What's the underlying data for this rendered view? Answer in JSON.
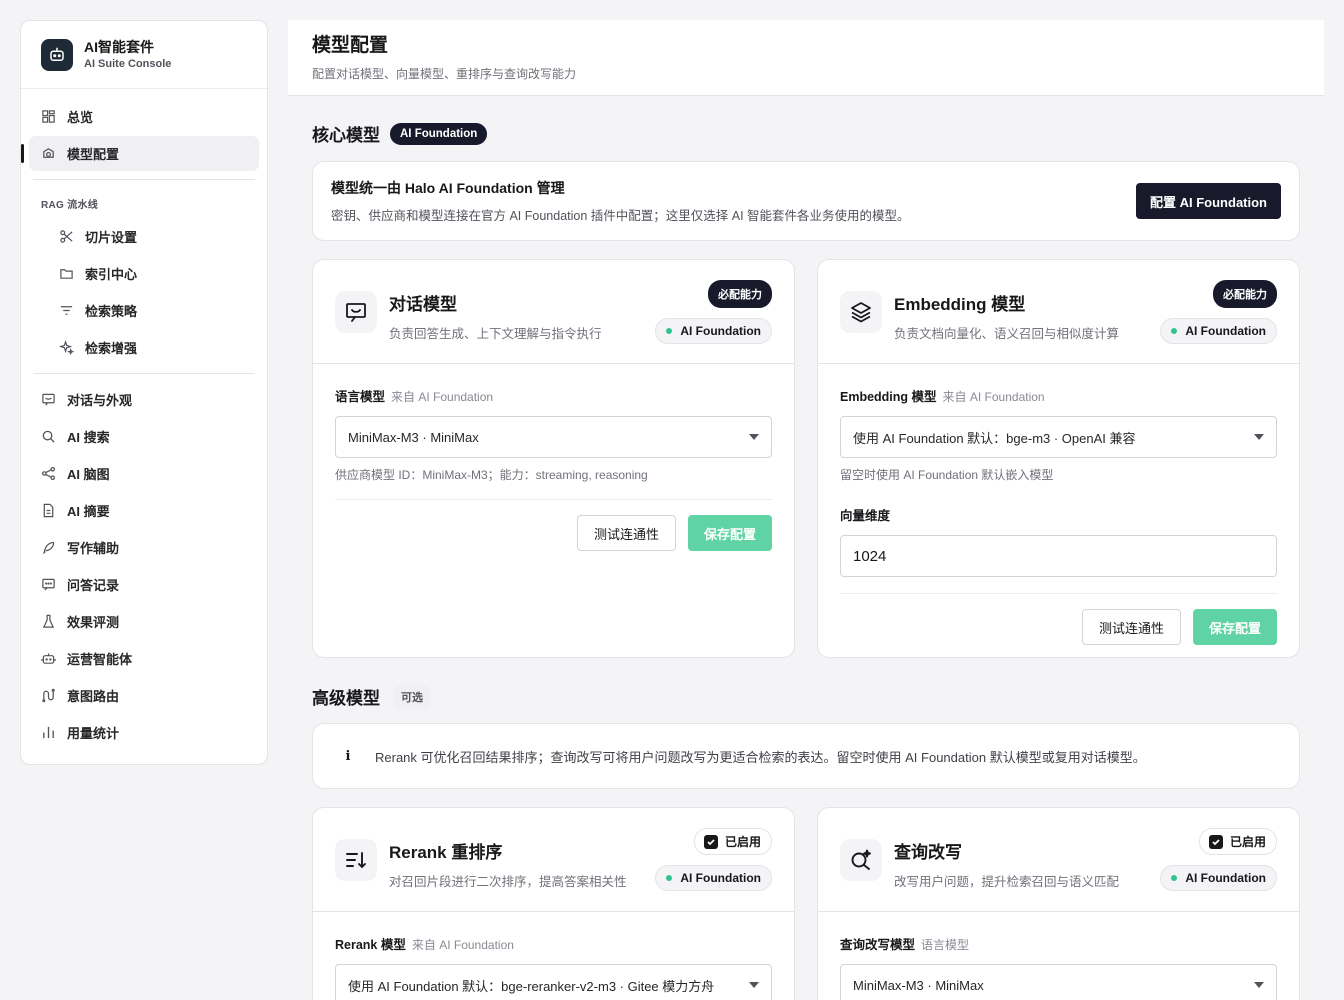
{
  "brand": {
    "title": "AI智能套件",
    "subtitle": "AI Suite Console"
  },
  "nav": {
    "items_top": [
      {
        "label": "总览",
        "icon": "grid-icon"
      },
      {
        "label": "模型配置",
        "icon": "model-icon",
        "active": true
      }
    ],
    "group_label": "RAG 流水线",
    "items_rag": [
      {
        "label": "切片设置",
        "icon": "scissors-icon"
      },
      {
        "label": "索引中心",
        "icon": "folder-icon"
      },
      {
        "label": "检索策略",
        "icon": "filter-icon"
      },
      {
        "label": "检索增强",
        "icon": "sparkle-icon"
      }
    ],
    "items_bottom": [
      {
        "label": "对话与外观",
        "icon": "chat-icon"
      },
      {
        "label": "AI 搜索",
        "icon": "search-icon"
      },
      {
        "label": "AI 脑图",
        "icon": "mindmap-icon"
      },
      {
        "label": "AI 摘要",
        "icon": "document-icon"
      },
      {
        "label": "写作辅助",
        "icon": "feather-icon"
      },
      {
        "label": "问答记录",
        "icon": "message-icon"
      },
      {
        "label": "效果评测",
        "icon": "flask-icon"
      },
      {
        "label": "运营智能体",
        "icon": "robot-icon"
      },
      {
        "label": "意图路由",
        "icon": "route-icon"
      },
      {
        "label": "用量统计",
        "icon": "bar-chart-icon"
      }
    ]
  },
  "header": {
    "title": "模型配置",
    "subtitle": "配置对话模型、向量模型、重排序与查询改写能力"
  },
  "core": {
    "title": "核心模型",
    "badge": "AI Foundation",
    "info_title": "模型统一由 Halo AI Foundation 管理",
    "info_desc": "密钥、供应商和模型连接在官方 AI Foundation 插件中配置；这里仅选择 AI 智能套件各业务使用的模型。",
    "config_button": "配置 AI Foundation"
  },
  "chat_card": {
    "title": "对话模型",
    "desc": "负责回答生成、上下文理解与指令执行",
    "badge_required": "必配能力",
    "badge_source": "AI Foundation",
    "field_label": "语言模型",
    "field_source": "来自 AI Foundation",
    "select_value": "MiniMax-M3 · MiniMax",
    "hint": "供应商模型 ID：MiniMax-M3；能力：streaming, reasoning",
    "test_button": "测试连通性",
    "save_button": "保存配置"
  },
  "embed_card": {
    "title": "Embedding 模型",
    "desc": "负责文档向量化、语义召回与相似度计算",
    "badge_required": "必配能力",
    "badge_source": "AI Foundation",
    "field_label": "Embedding 模型",
    "field_source": "来自 AI Foundation",
    "select_value": "使用 AI Foundation 默认：bge-m3 · OpenAI 兼容",
    "hint": "留空时使用 AI Foundation 默认嵌入模型",
    "dim_label": "向量维度",
    "dim_value": "1024",
    "test_button": "测试连通性",
    "save_button": "保存配置"
  },
  "advanced": {
    "title": "高级模型",
    "badge": "可选",
    "notice": "Rerank 可优化召回结果排序；查询改写可将用户问题改写为更适合检索的表达。留空时使用 AI Foundation 默认模型或复用对话模型。"
  },
  "rerank_card": {
    "title": "Rerank 重排序",
    "desc": "对召回片段进行二次排序，提高答案相关性",
    "badge_enabled": "已启用",
    "badge_source": "AI Foundation",
    "field_label": "Rerank 模型",
    "field_source": "来自 AI Foundation",
    "select_value": "使用 AI Foundation 默认：bge-reranker-v2-m3 · Gitee 模力方舟"
  },
  "rewrite_card": {
    "title": "查询改写",
    "desc": "改写用户问题，提升检索召回与语义匹配",
    "badge_enabled": "已启用",
    "badge_source": "AI Foundation",
    "field_label": "查询改写模型",
    "field_source": "语言模型",
    "select_value": "MiniMax-M3 · MiniMax"
  },
  "colors": {
    "accent_dark": "#18192b",
    "success": "#34c38f",
    "save_button": "#5fd3a3"
  }
}
